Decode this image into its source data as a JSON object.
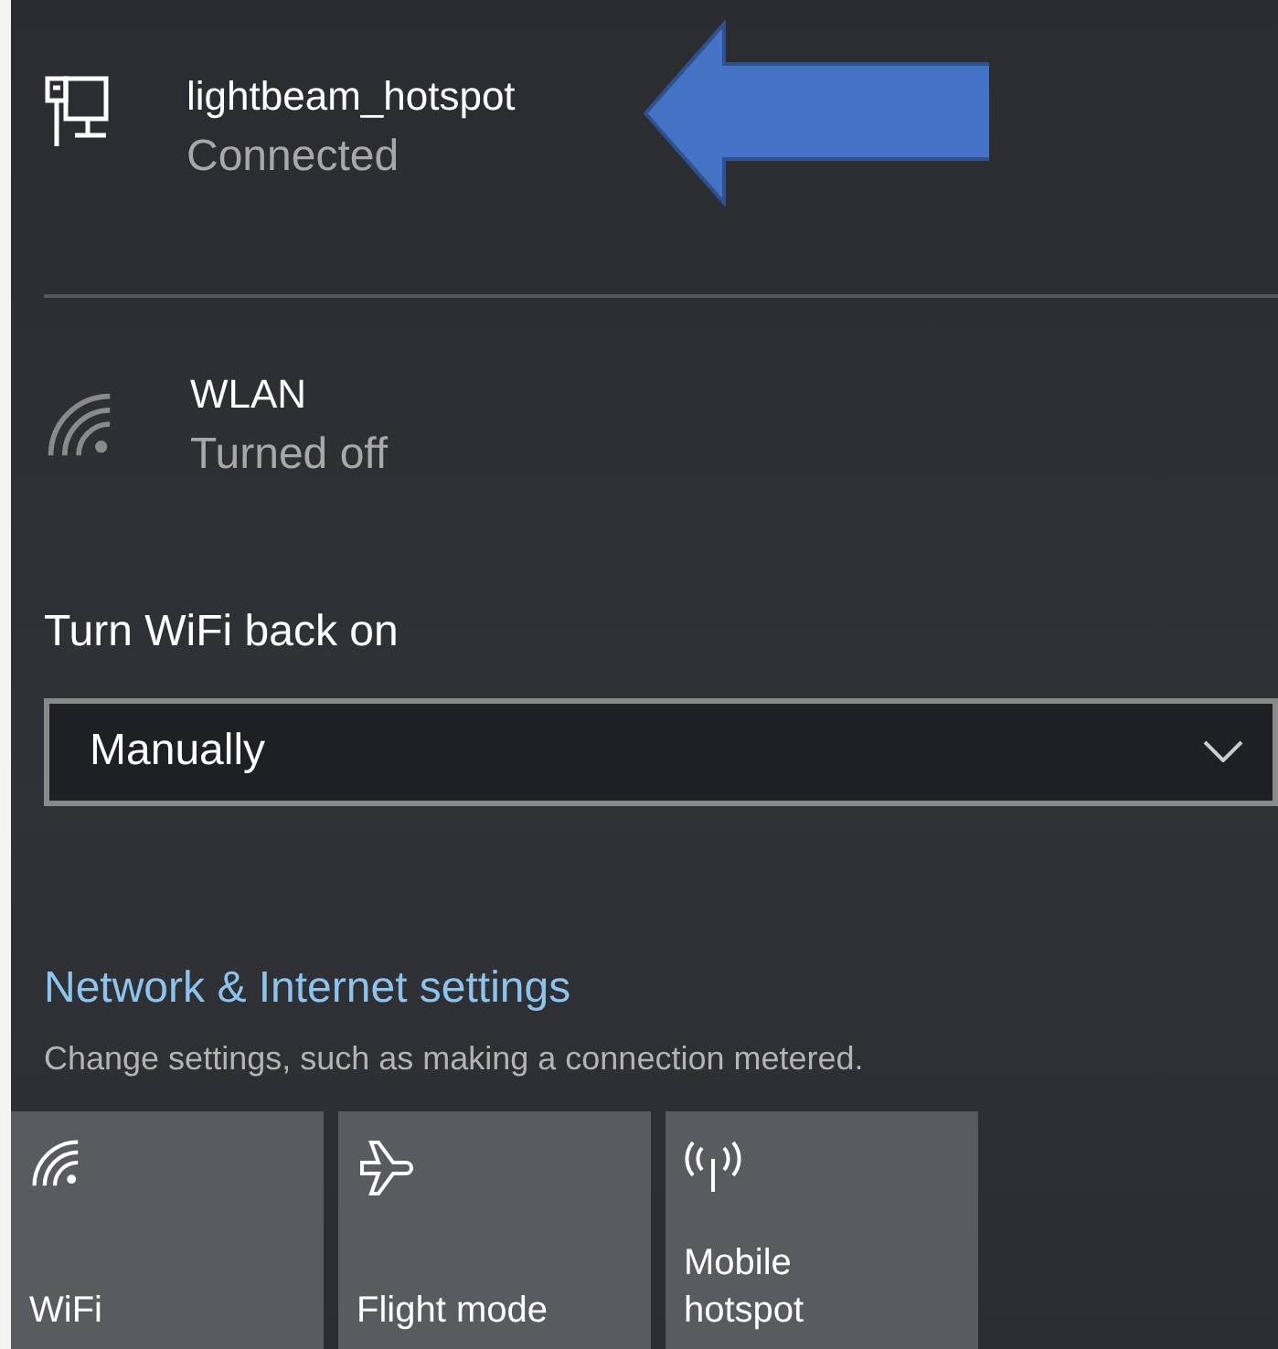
{
  "networks": [
    {
      "kind": "ethernet",
      "name": "lightbeam_hotspot",
      "status": "Connected",
      "enabled": true
    },
    {
      "kind": "wifi",
      "name": "WLAN",
      "status": "Turned off",
      "enabled": false
    }
  ],
  "turn_back_on": {
    "label": "Turn WiFi back on",
    "value": "Manually"
  },
  "settings_link": {
    "label": "Network & Internet settings",
    "description": "Change settings, such as making a connection metered."
  },
  "tiles": [
    {
      "kind": "wifi",
      "label": "WiFi",
      "on": false
    },
    {
      "kind": "flight",
      "label": "Flight mode",
      "on": false
    },
    {
      "kind": "hotspot",
      "label": "Mobile hotspot",
      "on": false
    }
  ]
}
